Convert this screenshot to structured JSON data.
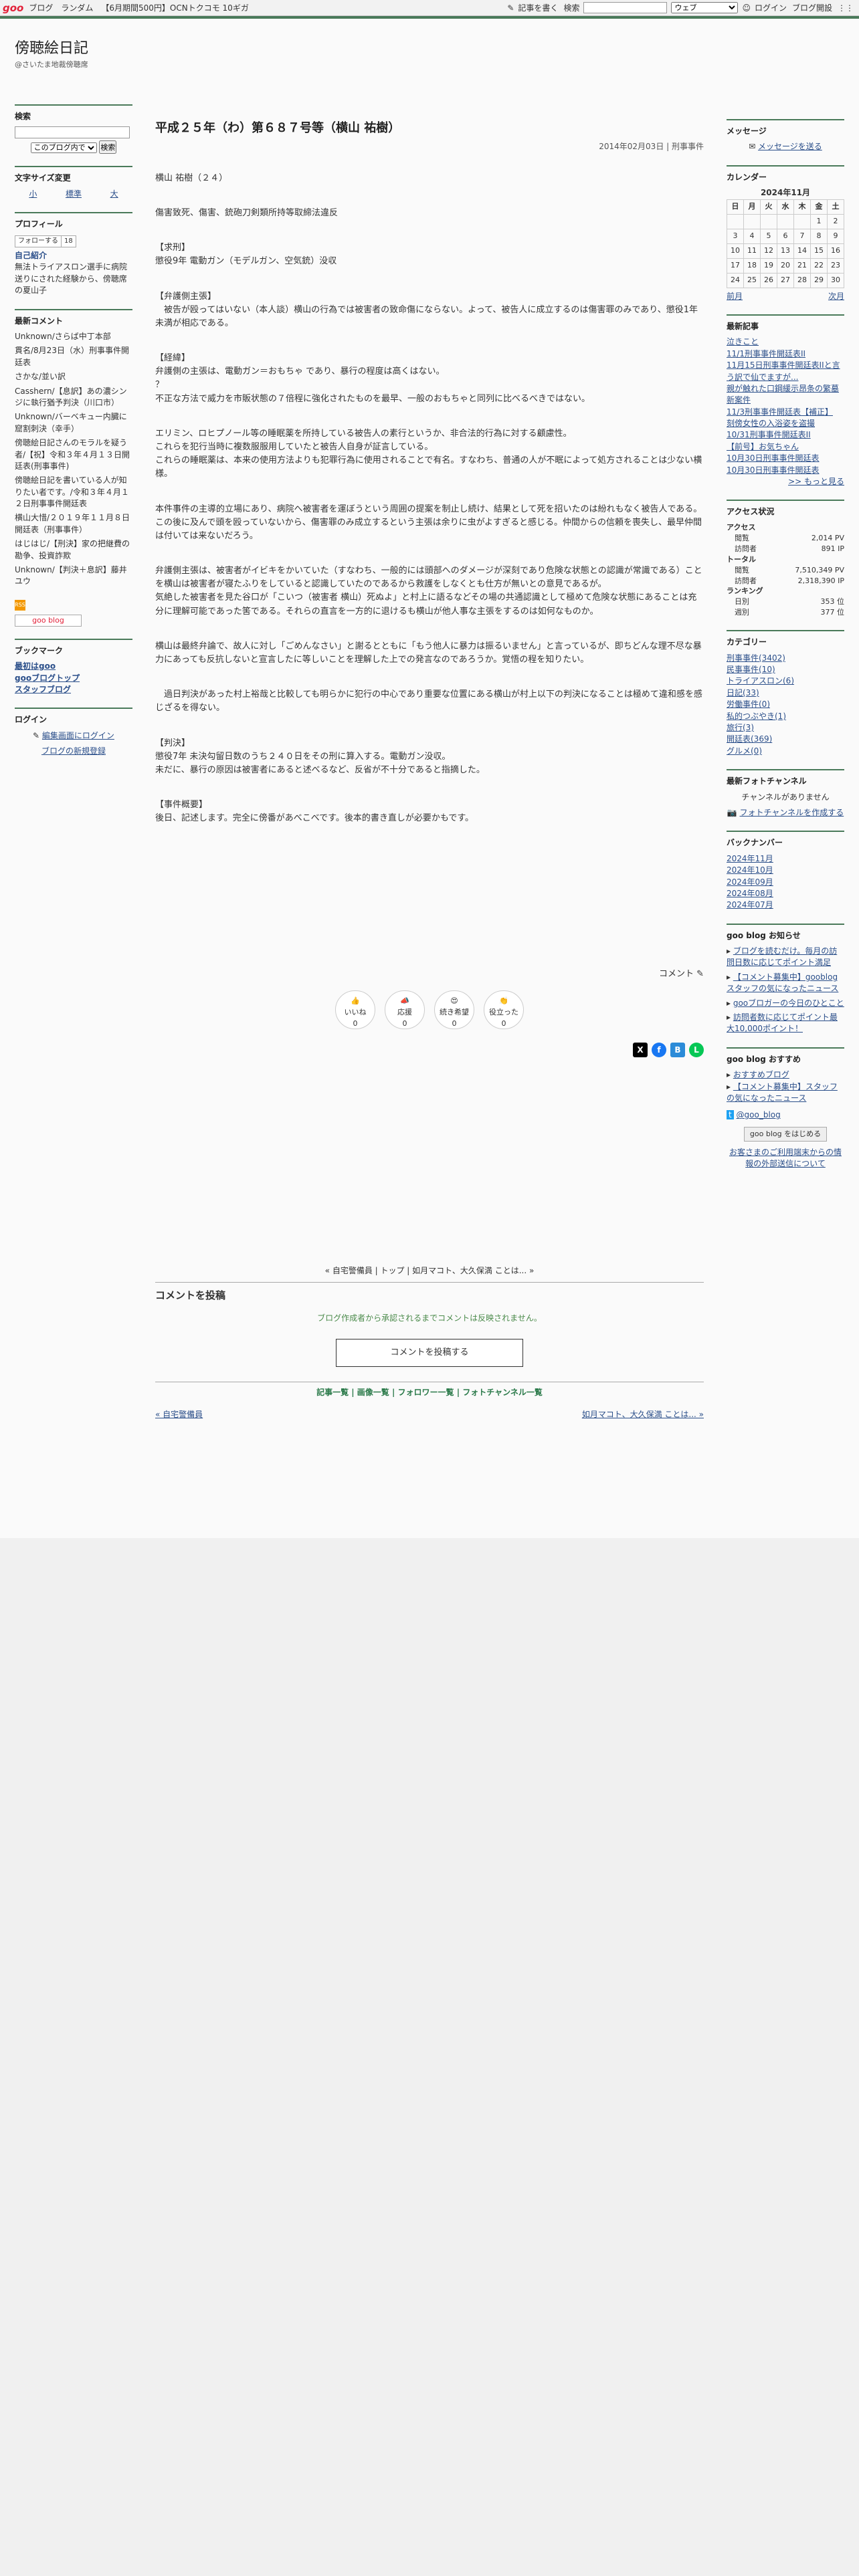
{
  "topbar": {
    "logo": "goo",
    "links": [
      "ブログ",
      "ランダム",
      "【6月期間500円】OCNトクコモ 10ギガ"
    ],
    "write": "記事を書く",
    "search_label": "検索",
    "select": "ウェブ",
    "login": "ログイン",
    "open": "ブログ開設"
  },
  "blog": {
    "title": "傍聴絵日記",
    "desc": "@さいたま地裁傍聴席"
  },
  "left": {
    "search": {
      "title": "検索",
      "option": "このブログ内で",
      "btn": "検索"
    },
    "fontsize": {
      "title": "文字サイズ変更",
      "small": "小",
      "mid": "標準",
      "large": "大"
    },
    "profile": {
      "title": "プロフィール",
      "follow": "フォローする",
      "count": "18",
      "self": "自己紹介",
      "text": "無法トライアスロン選手に病院送りにされた経験から、傍聴席の夏山子"
    },
    "comments": {
      "title": "最新コメント",
      "items": [
        "Unknown/さらば中丁本部",
        "貫名/8月23日（水）刑事事件開廷表",
        "さかな/並い訳",
        "Casshern/【息訳】あの濃シンジに執行猶予判決（川口市）",
        "Unknown/バーベキュー内臓に窟割刺決（幸手）",
        "傍聴絵日記さんのモラルを疑う者/【祝】令和３年４月１３日開廷表(刑事事件)",
        "傍聴絵日記を書いている人が知りたい者です。/令和３年４月１２日刑事事件開廷表",
        "横山大惜/２０１９年１１月８日開廷表（刑事事件）",
        "はじはじ/【刑決】家の把継費の勘争、投資詐欺",
        "Unknown/【判決＋息訳】藤井ユウ"
      ]
    },
    "rss": "RSS",
    "gooblog": "goo blog",
    "bookmark": {
      "title": "ブックマーク",
      "items": [
        "最初はgoo",
        "gooブログトップ",
        "スタッフブログ"
      ]
    },
    "login": {
      "title": "ログイン",
      "edit": "編集画面にログイン",
      "new": "ブログの新規登録"
    }
  },
  "main": {
    "title": "平成２５年（わ）第６８７号等（横山 祐樹）",
    "meta": "2014年02月03日 | 刑事事件",
    "paras": [
      "横山 祐樹（２４）",
      "傷害致死、傷害、銃砲刀剣類所持等取締法違反",
      "【求刑】\n懲役9年 電動ガン（モデルガン、空気銃）没収",
      "【弁護側主張】\n　被告が殴ってはいない（本人談）横山の行為では被害者の致命傷にならない。よって、被告人に成立するのは傷害罪のみであり、懲役1年未満が相応である。",
      "【経緯】\n弁護側の主張は、電動ガン＝おもちゃ であり、暴行の程度は高くはない。\n？\n不正な方法で威力を市販状態の７倍程に強化されたものを最早、一般のおもちゃと同列に比べるべきではない。",
      "エリミン、ロヒプノール等の睡眠薬を所持している被告人の素行というか、非合法的行為に対する顧慮性。\nこれらを犯行当時に複数服服用していたと被告人自身が証言している。\nこれらの睡眠薬は、本来の使用方法よりも犯罪行為に使用されることで有名。すなわち、普通の人が不眠によって処方されることは少ない横様。",
      "本件事件の主導的立場にあり、病院へ被害者を運ぼうという周囲の提案を制止し続け、結果として死を招いたのは紛れもなく被告人である。この後に及んで頭を殴っていないから、傷害罪のみ成立するという主張は余りに虫がよすぎると感じる。仲間からの信頼を喪失し、最早仲間は付いては来ないだろう。",
      "弁護側主張は、被害者がイビキをかいていた（すなわち、一般的には頭部へのダメージが深刻であり危険な状態との認識が常識である）ことを横山は被害者が寝たふりをしていると認識していたのであるから救護をしなくとも仕方が無いとの意見であるが。\n気絶した被害者を見た谷口が「こいつ（被害者 横山）死ぬよ」と村上に語るなどその場の共通認識として極めて危険な状態にあることは充分に理解可能であった筈である。それらの直言を一方的に退けるも横山が他人事な主張をするのは如何なものか。",
      "横山は最終弁論で、故人に対し「ごめんなさい」と謝るとともに「もう他人に暴力は振るいません」と言っているが、即ちどんな理不尽な暴力にあっても反抗しないと宣言したに等しいことを理解した上での発言なのであろうか。覚悟の程を知りたい。",
      "　過日判決があった村上裕哉と比較しても明らかに犯行の中心であり重要な位置にある横山が村上以下の判決になることは極めて違和感を感じざるを得ない。",
      "【判決】\n懲役7年 未決勾留日数のうち２４０日をその刑に算入する。電動ガン没収。\n未だに、暴行の原因は被害者にあると述べるなど、反省が不十分であると指摘した。",
      "【事件概要】\n後日、記述します。完全に傍番があべこべです。後本的書き直しが必要かもです。"
    ],
    "comment_link": "コメント",
    "reactions": [
      {
        "label": "いいね",
        "n": "0"
      },
      {
        "label": "応援",
        "n": "0"
      },
      {
        "label": "続き希望",
        "n": "0"
      },
      {
        "label": "役立った",
        "n": "0"
      }
    ],
    "pager_nav": "« 自宅警備員 | トップ | 如月マコト、大久保満 ことは... »",
    "post_title": "コメントを投稿",
    "post_note": "ブログ作成者から承認されるまでコメントは反映されません。",
    "post_btn": "コメントを投稿する",
    "lists": "記事一覧 | 画像一覧 | フォロワー一覧 | フォトチャンネル一覧",
    "prev": "« 自宅警備員",
    "next": "如月マコト、大久保満 ことは... »"
  },
  "right": {
    "message": {
      "title": "メッセージ",
      "link": "メッセージを送る"
    },
    "calendar": {
      "title": "カレンダー",
      "month": "2024年11月",
      "dow": [
        "日",
        "月",
        "火",
        "水",
        "木",
        "金",
        "土"
      ],
      "weeks": [
        [
          "",
          "",
          "",
          "",
          "",
          "1",
          "2"
        ],
        [
          "3",
          "4",
          "5",
          "6",
          "7",
          "8",
          "9"
        ],
        [
          "10",
          "11",
          "12",
          "13",
          "14",
          "15",
          "16"
        ],
        [
          "17",
          "18",
          "19",
          "20",
          "21",
          "22",
          "23"
        ],
        [
          "24",
          "25",
          "26",
          "27",
          "28",
          "29",
          "30"
        ]
      ],
      "prev": "前月",
      "next": "次月"
    },
    "recent": {
      "title": "最新記事",
      "items": [
        "泣きこと",
        "11/1刑事事件開廷表II",
        "11月15日刑事事件開廷表IIと言う訳で仙でますが...",
        "親が触れた口鋼緩示昂条の繁墓新案件",
        "11/3刑事事件開廷表【補正】",
        "刻傍女性の入浴姿を盗撮",
        "10/31刑事事件開廷表II",
        "【前号】お気ちゃん",
        "10月30日刑事事件開廷表",
        "10月30日刑事事件開廷表"
      ],
      "more": ">> もっと見る"
    },
    "access": {
      "title": "アクセス状況",
      "access": "アクセス",
      "view": "閲覧",
      "view_n": "2,014 PV",
      "visit": "訪問者",
      "visit_n": "891 IP",
      "total": "トータル",
      "tview_n": "7,510,349 PV",
      "tvisit_n": "2,318,390 IP",
      "rank": "ランキング",
      "daily": "日別",
      "daily_n": "353 位",
      "weekly": "週別",
      "weekly_n": "377 位"
    },
    "category": {
      "title": "カテゴリー",
      "items": [
        "刑事事件(3402)",
        "民事事件(10)",
        "トライアスロン(6)",
        "日記(33)",
        "労働事件(0)",
        "私的つぶやき(1)",
        "旅行(3)",
        "開廷表(369)",
        "グルメ(0)"
      ]
    },
    "photo": {
      "title": "最新フォトチャンネル",
      "none": "チャンネルがありません",
      "make": "フォトチャンネルを作成する"
    },
    "backnumber": {
      "title": "バックナンバー",
      "items": [
        "2024年11月",
        "2024年10月",
        "2024年09月",
        "2024年08月",
        "2024年07月"
      ]
    },
    "notice": {
      "title": "goo blog お知らせ",
      "items": [
        "ブログを読むだけ。毎月の訪問日数に応じてポイント満足",
        "【コメント募集中】gooblogスタッフの気になったニュース",
        "gooブロガーの今日のひとこと",
        "訪問者数に応じてポイント最大10,000ポイント！"
      ]
    },
    "recommend": {
      "title": "goo blog おすすめ",
      "items": [
        "おすすめブログ",
        "【コメント募集中】スタッフの気になったニュース"
      ],
      "twitter": "@goo_blog",
      "start": "goo blog をはじめる",
      "ext": "お客さまのご利用端末からの情報の外部送信について"
    }
  }
}
